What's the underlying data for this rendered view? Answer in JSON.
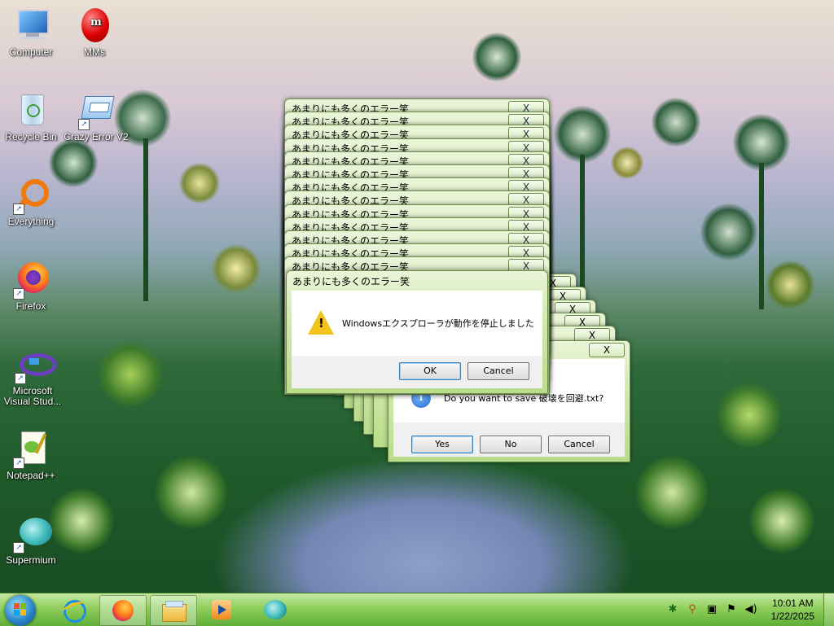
{
  "desktop_icons": [
    {
      "label": "Computer",
      "icon": "computer-icon"
    },
    {
      "label": "MMs",
      "icon": "mms-icon"
    },
    {
      "label": "Recycle Bin",
      "icon": "recycle-bin-icon"
    },
    {
      "label": "Crazy Error V2",
      "icon": "crazy-error-icon"
    },
    {
      "label": "Everything",
      "icon": "everything-icon"
    },
    {
      "label": "Firefox",
      "icon": "firefox-icon"
    },
    {
      "label": "Microsoft Visual Stud...",
      "icon": "visual-studio-icon"
    },
    {
      "label": "Notepad++",
      "icon": "notepad-plus-plus-icon"
    },
    {
      "label": "Supermium",
      "icon": "supermium-icon"
    }
  ],
  "error_window_title": "あまりにも多くのエラー笑",
  "close_glyph": "X",
  "front_dialog": {
    "title": "あまりにも多くのエラー笑",
    "message": "Windowsエクスプローラが動作を停止しました",
    "ok_label": "OK",
    "cancel_label": "Cancel"
  },
  "save_dialog": {
    "message": "Do you want to save 破壊を回避.txt?",
    "yes_label": "Yes",
    "no_label": "No",
    "cancel_label": "Cancel"
  },
  "taskbar": {
    "pinned": [
      "internet-explorer-icon",
      "firefox-icon",
      "file-explorer-icon",
      "media-player-icon",
      "supermium-icon"
    ],
    "clock_time": "10:01 AM",
    "clock_date": "1/22/2025"
  },
  "colors": {
    "window_frame": "#cfe8a9",
    "taskbar": "#8fcf5c",
    "warning": "#f2c31a",
    "info": "#1f6fcf"
  }
}
